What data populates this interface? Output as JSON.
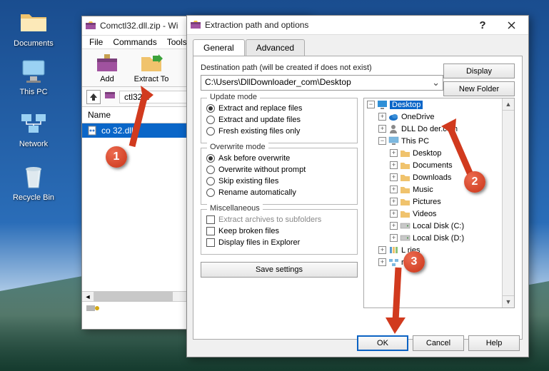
{
  "desktop": {
    "icons": [
      {
        "label": "Documents",
        "glyph": "folder"
      },
      {
        "label": "This PC",
        "glyph": "pc"
      },
      {
        "label": "Network",
        "glyph": "network"
      },
      {
        "label": "Recycle Bin",
        "glyph": "bin"
      }
    ]
  },
  "winrar": {
    "title": "Comctl32.dll.zip - Wi",
    "menus": [
      "File",
      "Commands",
      "Tools"
    ],
    "toolbar": [
      {
        "label": "Add",
        "icon": "add"
      },
      {
        "label": "Extract To",
        "icon": "extract"
      }
    ],
    "breadcrumb_name": "ctl32.d",
    "column_name": "Name",
    "files": [
      {
        "name": "co        32.dll",
        "selected": true
      }
    ]
  },
  "extract": {
    "title": "Extraction path and options",
    "tabs": {
      "general": "General",
      "advanced": "Advanced"
    },
    "dest_label": "Destination path (will be created if does not exist)",
    "dest_path": "C:\\Users\\DllDownloader_com\\Desktop",
    "btn_display": "Display",
    "btn_newfolder": "New Folder",
    "update_mode": {
      "title": "Update mode",
      "opts": [
        "Extract and replace files",
        "Extract and update files",
        "Fresh existing files only"
      ],
      "selected": 0
    },
    "overwrite_mode": {
      "title": "Overwrite mode",
      "opts": [
        "Ask before overwrite",
        "Overwrite without prompt",
        "Skip existing files",
        "Rename automatically"
      ],
      "selected": 0
    },
    "misc": {
      "title": "Miscellaneous",
      "opts": [
        "Extract archives to subfolders",
        "Keep broken files",
        "Display files in Explorer"
      ]
    },
    "btn_save": "Save settings",
    "tree": [
      {
        "indent": 0,
        "exp": "minus",
        "icon": "desktop",
        "label": "Desktop",
        "sel": true
      },
      {
        "indent": 1,
        "exp": "plus",
        "icon": "onedrive",
        "label": "OneDrive"
      },
      {
        "indent": 1,
        "exp": "plus",
        "icon": "user",
        "label": "DLL Do         der.com"
      },
      {
        "indent": 1,
        "exp": "minus",
        "icon": "pc",
        "label": "This PC"
      },
      {
        "indent": 2,
        "exp": "plus",
        "icon": "folder",
        "label": "Desktop"
      },
      {
        "indent": 2,
        "exp": "plus",
        "icon": "folder",
        "label": "Documents"
      },
      {
        "indent": 2,
        "exp": "plus",
        "icon": "folder",
        "label": "Downloads"
      },
      {
        "indent": 2,
        "exp": "plus",
        "icon": "folder",
        "label": "Music"
      },
      {
        "indent": 2,
        "exp": "plus",
        "icon": "folder",
        "label": "Pictures"
      },
      {
        "indent": 2,
        "exp": "plus",
        "icon": "folder",
        "label": "Videos"
      },
      {
        "indent": 2,
        "exp": "plus",
        "icon": "disk",
        "label": "Local Disk (C:)"
      },
      {
        "indent": 2,
        "exp": "plus",
        "icon": "disk",
        "label": "Local Disk (D:)"
      },
      {
        "indent": 1,
        "exp": "plus",
        "icon": "lib",
        "label": "L      ries"
      },
      {
        "indent": 1,
        "exp": "plus",
        "icon": "net",
        "label": "         rk"
      }
    ],
    "btn_ok": "OK",
    "btn_cancel": "Cancel",
    "btn_help": "Help"
  },
  "callouts": {
    "c1": "1",
    "c2": "2",
    "c3": "3"
  }
}
